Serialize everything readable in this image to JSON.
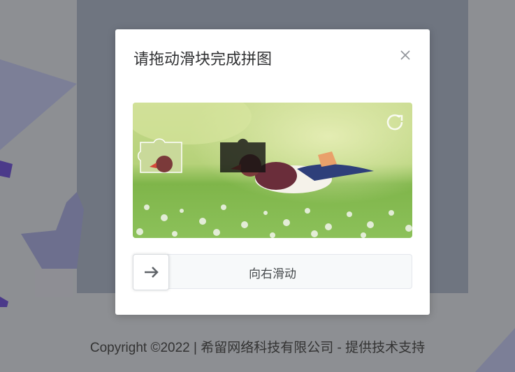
{
  "dialog": {
    "title": "请拖动滑块完成拼图",
    "slider_text": "向右滑动"
  },
  "footer": {
    "text": "Copyright ©2022 | 希留网络科技有限公司 - 提供技术支持"
  },
  "icons": {
    "close": "close-icon",
    "refresh": "refresh-icon",
    "arrow": "arrow-right-icon"
  },
  "colors": {
    "overlay": "#8d8f93",
    "modal_bg": "#ffffff",
    "slider_bg": "#f7f9fa"
  }
}
